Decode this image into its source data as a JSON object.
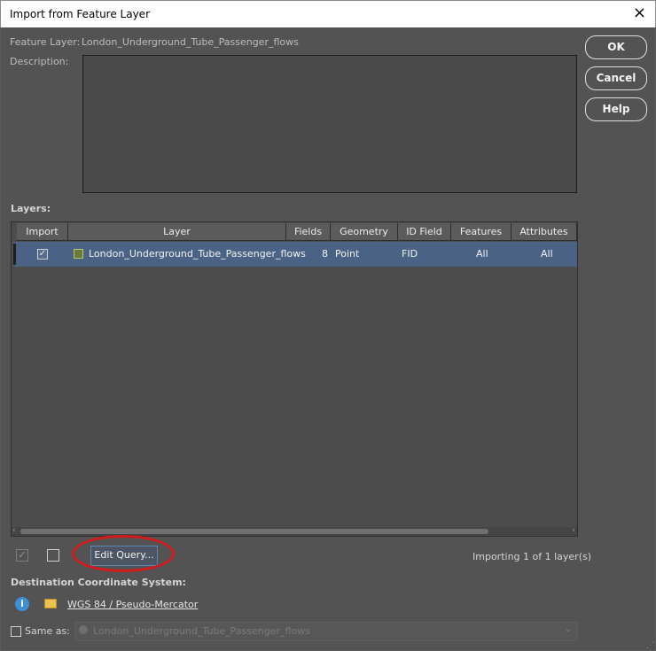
{
  "window": {
    "title": "Import from Feature Layer",
    "close_glyph": "×"
  },
  "feature_layer": {
    "label": "Feature Layer:",
    "value": "London_Underground_Tube_Passenger_flows"
  },
  "description": {
    "label": "Description:"
  },
  "buttons": {
    "ok": "OK",
    "cancel": "Cancel",
    "help": "Help",
    "edit_query": "Edit Query..."
  },
  "layers": {
    "label": "Layers:",
    "columns": [
      "Import",
      "Layer",
      "Fields",
      "Geometry",
      "ID Field",
      "Features",
      "Attributes"
    ],
    "rows": [
      {
        "import_checked": true,
        "layer": "London_Underground_Tube_Passenger_flows",
        "fields": "8",
        "geometry": "Point",
        "id_field": "FID",
        "features": "All",
        "attributes": "All"
      }
    ]
  },
  "status": {
    "importing": "Importing 1 of 1 layer(s)"
  },
  "destination": {
    "label": "Destination Coordinate System:",
    "coord_system": "WGS 84 / Pseudo-Mercator",
    "same_as_label": "Same as:",
    "same_as_value": "London_Underground_Tube_Passenger_flows"
  },
  "colors": {
    "accent": "#4a6384",
    "highlight": "#d11a1a",
    "info": "#3d8fd6"
  }
}
